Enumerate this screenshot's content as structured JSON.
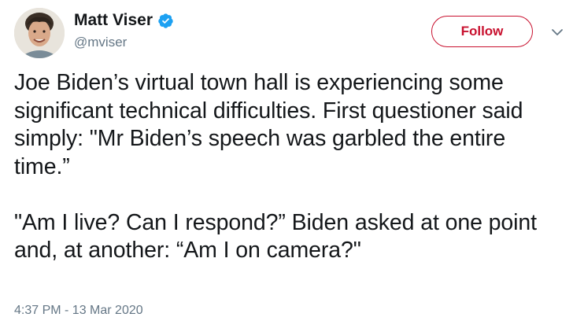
{
  "user": {
    "display_name": "Matt Viser",
    "handle": "@mviser",
    "verified_icon": "verified-badge-icon",
    "avatar_icon": "avatar"
  },
  "actions": {
    "follow_label": "Follow",
    "more_icon": "chevron-down-icon"
  },
  "tweet": {
    "text": "Joe Biden’s virtual town hall is experiencing some significant technical difficulties. First questioner said simply: \"Mr Biden’s speech was garbled the entire time.”\n\n\"Am I live? Can I respond?” Biden asked at one point and, at another: “Am I on camera?\"",
    "timestamp": "4:37 PM - 13 Mar 2020"
  },
  "colors": {
    "text": "#14171a",
    "secondary": "#657786",
    "follow_accent": "#c8102e",
    "verified": "#1da1f2"
  }
}
